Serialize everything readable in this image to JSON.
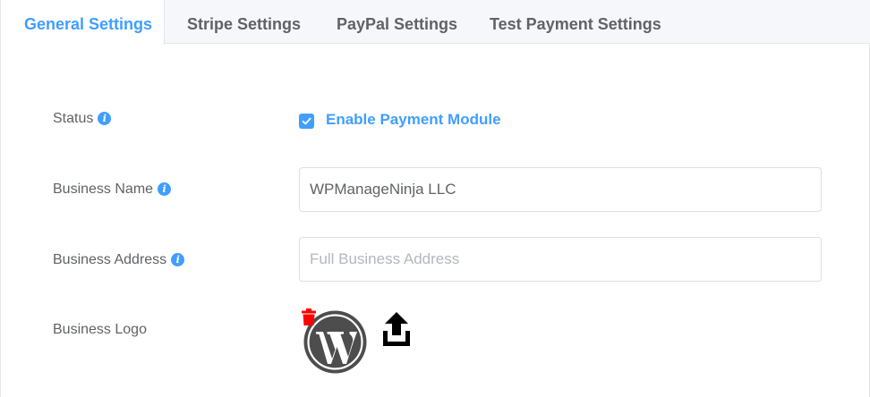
{
  "tabs": [
    {
      "label": "General Settings",
      "active": true
    },
    {
      "label": "Stripe Settings",
      "active": false
    },
    {
      "label": "PayPal Settings",
      "active": false
    },
    {
      "label": "Test Payment Settings",
      "active": false
    }
  ],
  "form": {
    "status": {
      "label": "Status",
      "checkbox_label": "Enable Payment Module",
      "checked": true
    },
    "business_name": {
      "label": "Business Name",
      "value": "WPManageNinja LLC",
      "placeholder": ""
    },
    "business_address": {
      "label": "Business Address",
      "value": "",
      "placeholder": "Full Business Address"
    },
    "business_logo": {
      "label": "Business Logo",
      "logo": "wordpress-logo-icon",
      "delete_icon": "trash-icon",
      "upload_icon": "upload-icon"
    }
  },
  "info_glyph": "i",
  "colors": {
    "accent": "#409eff",
    "text": "#606266",
    "danger": "#ff0000",
    "tab_bg": "#f5f7fa",
    "border": "#dcdfe6"
  }
}
